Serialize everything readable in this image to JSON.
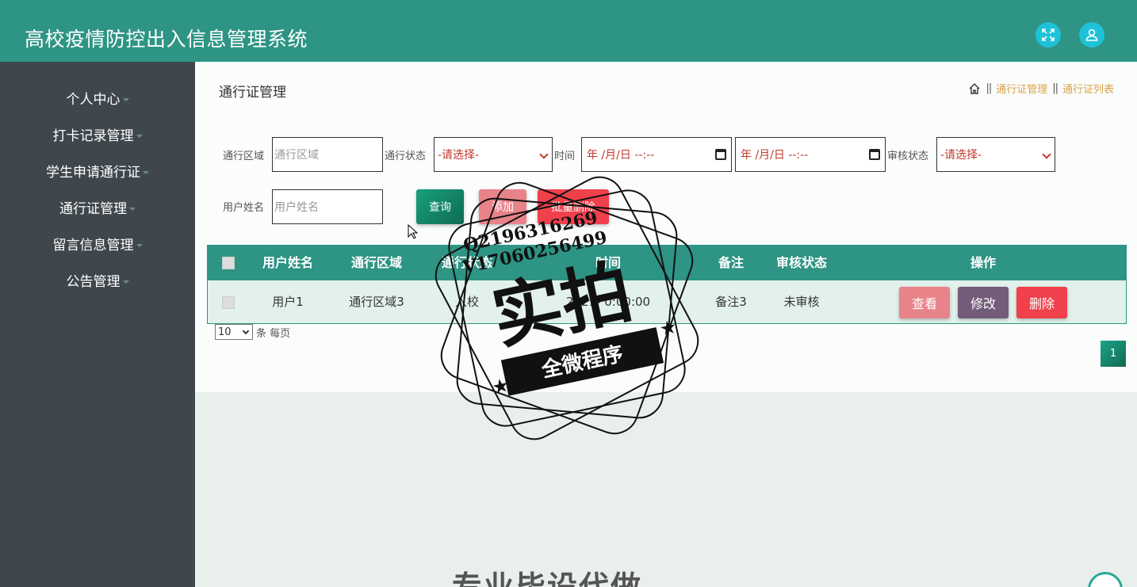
{
  "app": {
    "title": "高校疫情防控出入信息管理系统"
  },
  "header": {
    "fullscreen_icon": "expand-icon",
    "user_icon": "user-icon"
  },
  "sidebar": {
    "items": [
      {
        "label": "个人中心"
      },
      {
        "label": "打卡记录管理"
      },
      {
        "label": "学生申请通行证"
      },
      {
        "label": "通行证管理"
      },
      {
        "label": "留言信息管理"
      },
      {
        "label": "公告管理"
      }
    ]
  },
  "page": {
    "title": "通行证管理",
    "breadcrumb": {
      "home_icon": "home-icon",
      "sep": "||",
      "level1": "通行证管理",
      "level2": "通行证列表"
    }
  },
  "filters": {
    "area_label": "通行区域",
    "area_placeholder": "通行区域",
    "status_label": "通行状态",
    "status_value": "-请选择-",
    "time_label": "时间",
    "time_start": "年 /月/日 --:--",
    "time_end": "年 /月/日 --:--",
    "audit_label": "审核状态",
    "audit_value": "-请选择-",
    "name_label": "用户姓名",
    "name_placeholder": "用户姓名"
  },
  "actions": {
    "search": "查询",
    "add": "添加",
    "batch_delete": "批量删除"
  },
  "table": {
    "headers": [
      "用户姓名",
      "通行区域",
      "通行状态",
      "时间",
      "备注",
      "审核状态",
      "操作"
    ],
    "rows": [
      {
        "name": "用户1",
        "area": "通行区域3",
        "status": "入校",
        "time": "2021-    0:00:00",
        "remark": "备注3",
        "audit": "未审核"
      }
    ],
    "row_actions": {
      "view": "查看",
      "edit": "修改",
      "delete": "删除"
    }
  },
  "pagination": {
    "page_size": "10",
    "per_page_label": "条 每页",
    "current_page": "1"
  },
  "watermark": {
    "line1": "Q2196316269",
    "line2": "V17060256499",
    "main": "实拍",
    "ribbon": "全微程序"
  },
  "footer": {
    "banner_text": "专业毕设代做"
  },
  "colors": {
    "header": "#2e9484",
    "sidebar": "#3f474d",
    "accent": "#1ec2d8",
    "view_btn": "#e8838a",
    "edit_btn": "#735c7a",
    "delete_btn": "#f0404c"
  }
}
